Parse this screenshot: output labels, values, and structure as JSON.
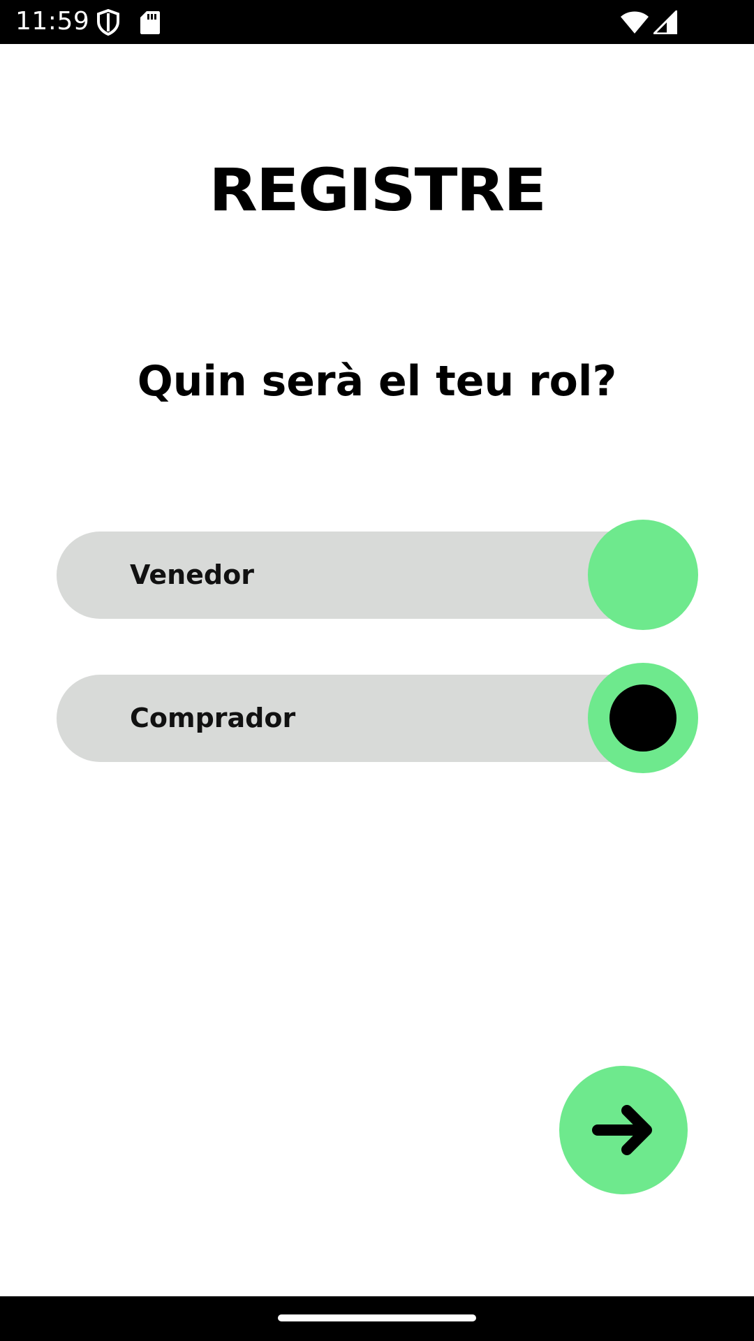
{
  "status_bar": {
    "time": "11:59",
    "icons": [
      "shield-icon",
      "sd-card-icon",
      "wifi-icon",
      "cell-signal-icon"
    ]
  },
  "header": {
    "title": "REGISTRE"
  },
  "main": {
    "question": "Quin serà el teu rol?",
    "options": [
      {
        "label": "Venedor",
        "selected": false
      },
      {
        "label": "Comprador",
        "selected": true
      }
    ],
    "next_button_icon": "arrow-right-icon"
  },
  "colors": {
    "accent": "#6ee98d",
    "option_bg": "#d8dad8",
    "text": "#000000"
  }
}
